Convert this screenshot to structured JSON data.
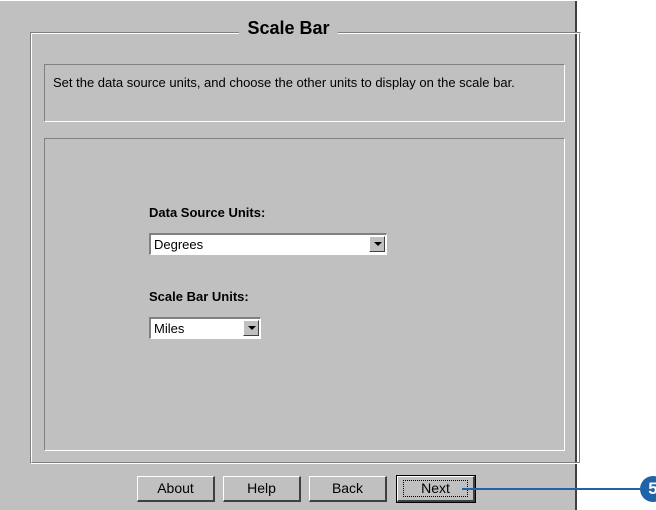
{
  "dialog": {
    "title": "Scale Bar",
    "description": "Set the data source units, and choose the other units to display on the scale bar."
  },
  "fields": {
    "data_source_units": {
      "label": "Data Source Units:",
      "value": "Degrees"
    },
    "scale_bar_units": {
      "label": "Scale Bar Units:",
      "value": "Miles"
    }
  },
  "buttons": {
    "about": "About",
    "help": "Help",
    "back": "Back",
    "next": "Next"
  },
  "callout": {
    "label": "5",
    "color": "#1f64a6"
  }
}
